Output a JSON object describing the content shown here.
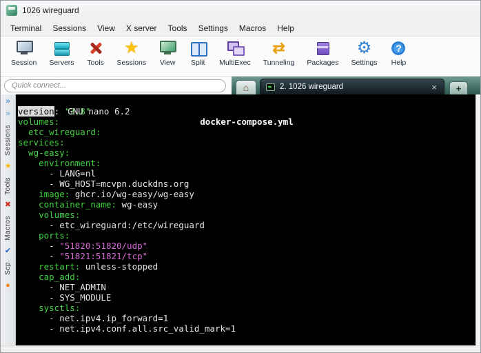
{
  "window": {
    "title": "1026 wireguard"
  },
  "menu_bar": {
    "items": [
      "Terminal",
      "Sessions",
      "View",
      "X server",
      "Tools",
      "Settings",
      "Macros",
      "Help"
    ]
  },
  "toolbar": {
    "items": [
      {
        "label": "Session",
        "icon": "session"
      },
      {
        "label": "Servers",
        "icon": "servers"
      },
      {
        "label": "Tools",
        "icon": "tools"
      },
      {
        "label": "Sessions",
        "icon": "sessions-star",
        "glyph": "★"
      },
      {
        "label": "View",
        "icon": "view"
      },
      {
        "label": "Split",
        "icon": "split"
      },
      {
        "label": "MultiExec",
        "icon": "multiexec"
      },
      {
        "label": "Tunneling",
        "icon": "tunneling",
        "glyph": "⇄"
      },
      {
        "label": "Packages",
        "icon": "packages"
      },
      {
        "label": "Settings",
        "icon": "settings",
        "glyph": "⚙"
      },
      {
        "label": "Help",
        "icon": "help",
        "glyph": "?"
      }
    ]
  },
  "quick_connect": {
    "placeholder": "Quick connect..."
  },
  "tab_bar": {
    "home_glyph": "⌂",
    "active_tab": {
      "label": "2. 1026 wireguard",
      "close_glyph": "×"
    },
    "new_tab_glyph": "+"
  },
  "sidebar": {
    "entries": [
      {
        "type": "icon",
        "name": "collapse-sidebar-icon",
        "glyph": "»",
        "color": "#1f7ad4"
      },
      {
        "type": "icon",
        "name": "pin-sidebar-icon",
        "glyph": "»",
        "color": "#55a0e0"
      },
      {
        "type": "label",
        "text": "Sessions"
      },
      {
        "type": "icon",
        "name": "star-icon",
        "glyph": "★",
        "color": "#f2b705"
      },
      {
        "type": "label",
        "text": "Tools"
      },
      {
        "type": "icon",
        "name": "tools-icon",
        "glyph": "✖",
        "color": "#d03020"
      },
      {
        "type": "label",
        "text": "Macros"
      },
      {
        "type": "icon",
        "name": "macros-icon",
        "glyph": "✔",
        "color": "#2266cc"
      },
      {
        "type": "label",
        "text": "Scp"
      },
      {
        "type": "icon",
        "name": "scp-icon",
        "glyph": "●",
        "color": "#f07f13"
      }
    ]
  },
  "terminal": {
    "nano_title_left": "GNU nano 6.2",
    "nano_title_center": "docker-compose.yml",
    "colors": {
      "background": "#000000",
      "key": "#3fd23f",
      "plain": "#e6e6e6",
      "string": "#d46ad4",
      "cursor_bg": "#dcdcdc",
      "cursor_fg": "#000000"
    },
    "lines": [
      [
        [
          "c",
          "version"
        ],
        [
          "p",
          ":"
        ],
        [
          "k",
          " \"3.8\""
        ]
      ],
      [
        [
          "k",
          "volumes:"
        ]
      ],
      [
        [
          "k",
          "  etc_wireguard:"
        ]
      ],
      [
        [
          "k",
          "services:"
        ]
      ],
      [
        [
          "k",
          "  wg-easy:"
        ]
      ],
      [
        [
          "k",
          "    environment:"
        ]
      ],
      [
        [
          "p",
          "      - LANG=nl"
        ]
      ],
      [
        [
          "p",
          "      - WG_HOST=mcvpn.duckdns.org"
        ]
      ],
      [
        [
          "k",
          "    image:"
        ],
        [
          "p",
          " ghcr.io/wg-easy/wg-easy"
        ]
      ],
      [
        [
          "k",
          "    container_name:"
        ],
        [
          "p",
          " wg-easy"
        ]
      ],
      [
        [
          "k",
          "    volumes:"
        ]
      ],
      [
        [
          "p",
          "      - etc_wireguard:/etc/wireguard"
        ]
      ],
      [
        [
          "k",
          "    ports:"
        ]
      ],
      [
        [
          "p",
          "      - "
        ],
        [
          "s",
          "\"51820:51820/udp\""
        ]
      ],
      [
        [
          "p",
          "      - "
        ],
        [
          "s",
          "\"51821:51821/tcp\""
        ]
      ],
      [
        [
          "k",
          "    restart:"
        ],
        [
          "p",
          " unless-stopped"
        ]
      ],
      [
        [
          "k",
          "    cap_add:"
        ]
      ],
      [
        [
          "p",
          "      - NET_ADMIN"
        ]
      ],
      [
        [
          "p",
          "      - SYS_MODULE"
        ]
      ],
      [
        [
          "k",
          "    sysctls:"
        ]
      ],
      [
        [
          "p",
          "      - net.ipv4.ip_forward=1"
        ]
      ],
      [
        [
          "p",
          "      - net.ipv4.conf.all.src_valid_mark=1"
        ]
      ]
    ]
  }
}
